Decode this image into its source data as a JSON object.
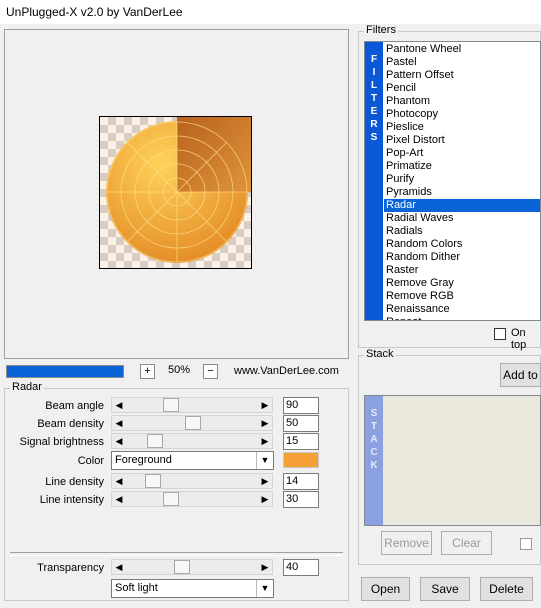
{
  "window": {
    "title": "UnPlugged-X v2.0 by VanDerLee"
  },
  "preview": {
    "zoom_label": "50%",
    "plus_label": "+",
    "minus_label": "−",
    "website": "www.VanDerLee.com",
    "progress_fraction": 1.0
  },
  "params": {
    "group_label": "Radar",
    "sliders": [
      {
        "label": "Beam angle",
        "value": "90",
        "fraction": 0.3
      },
      {
        "label": "Beam density",
        "value": "50",
        "fraction": 0.5
      },
      {
        "label": "Signal brightness",
        "value": "15",
        "fraction": 0.15
      }
    ],
    "color": {
      "label": "Color",
      "selected": "Foreground",
      "swatch": "#f5a037"
    },
    "sliders2": [
      {
        "label": "Line density",
        "value": "14",
        "fraction": 0.14
      },
      {
        "label": "Line intensity",
        "value": "30",
        "fraction": 0.3
      }
    ],
    "transparency": {
      "label": "Transparency",
      "value": "40",
      "fraction": 0.4
    },
    "blend_mode": "Soft light"
  },
  "filters": {
    "group_label": "Filters",
    "vertical_label": [
      "F",
      "I",
      "L",
      "T",
      "E",
      "R",
      "S"
    ],
    "items": [
      "Pantone Wheel",
      "Pastel",
      "Pattern Offset",
      "Pencil",
      "Phantom",
      "Photocopy",
      "Pieslice",
      "Pixel Distort",
      "Pop-Art",
      "Primatize",
      "Purify",
      "Pyramids",
      "Radar",
      "Radial Waves",
      "Radials",
      "Random Colors",
      "Random Dither",
      "Raster",
      "Remove Gray",
      "Remove RGB",
      "Renaissance",
      "Repeat"
    ],
    "selected": "Radar",
    "on_top_label": "On top"
  },
  "stack": {
    "group_label": "Stack",
    "vertical_label": [
      "S",
      "T",
      "A",
      "C",
      "K"
    ],
    "add_label": "Add to",
    "remove_label": "Remove",
    "clear_label": "Clear"
  },
  "buttons": {
    "open": "Open",
    "save": "Save",
    "delete": "Delete"
  },
  "colors": {
    "accent": "#0a64d8",
    "radar_light": "#ffd25a",
    "radar_dark": "#b8621e"
  }
}
